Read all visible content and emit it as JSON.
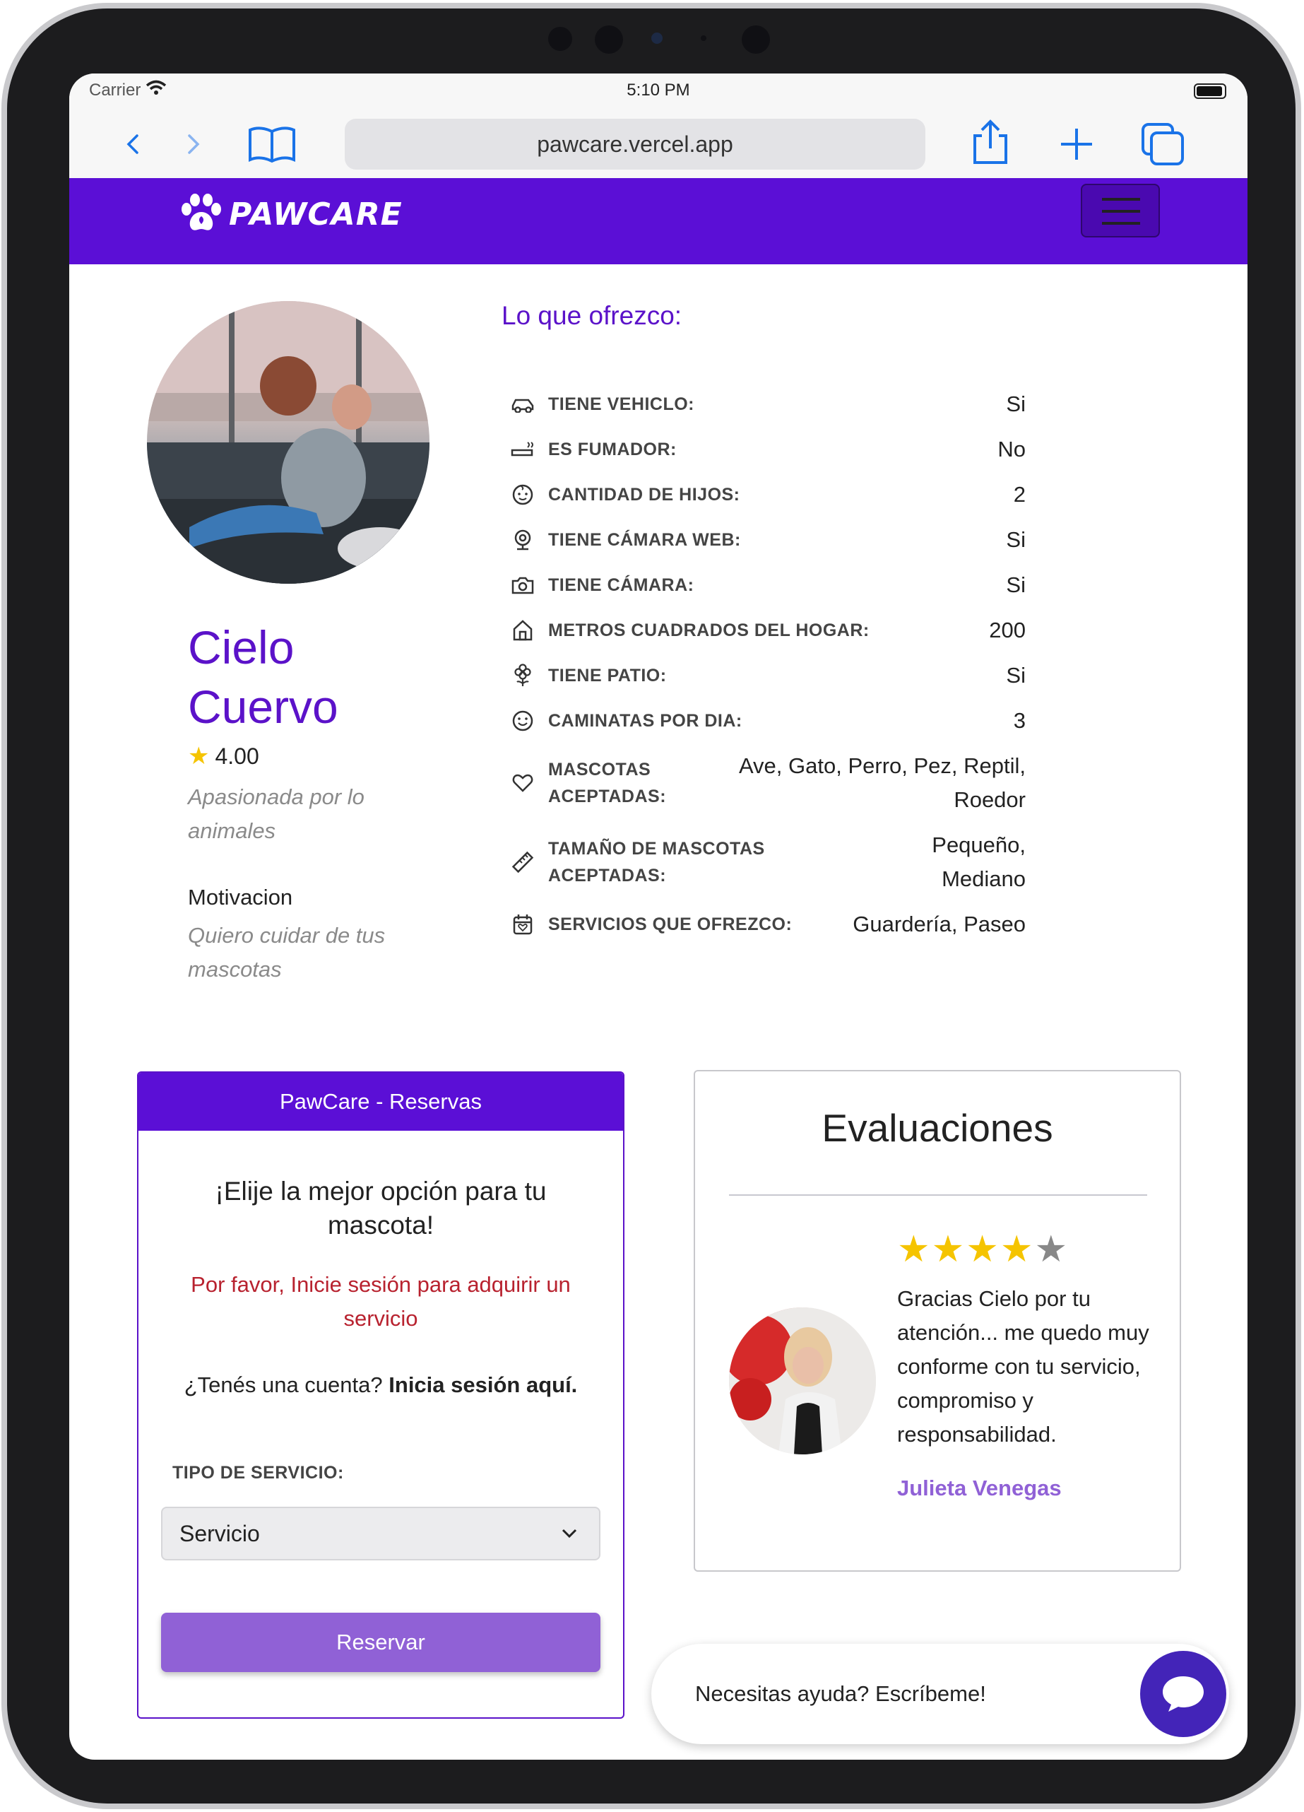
{
  "status_bar": {
    "carrier": "Carrier",
    "time": "5:10 PM"
  },
  "browser": {
    "url": "pawcare.vercel.app"
  },
  "navbar": {
    "brand": "PAWCARE"
  },
  "profile": {
    "name": "Cielo Cuervo",
    "rating": "4.00",
    "bio": "Apasionada por lo animales",
    "motivation_title": "Motivacion",
    "motivation_text": "Quiero cuidar de tus mascotas"
  },
  "offers": {
    "title": "Lo que ofrezco:",
    "items": [
      {
        "icon": "car-icon",
        "label": "TIENE VEHICLO:",
        "value": "Si"
      },
      {
        "icon": "smoking-icon",
        "label": "ES FUMADOR:",
        "value": "No"
      },
      {
        "icon": "baby-icon",
        "label": "CANTIDAD DE HIJOS:",
        "value": "2"
      },
      {
        "icon": "webcam-icon",
        "label": "TIENE CÁMARA WEB:",
        "value": "Si"
      },
      {
        "icon": "camera-icon",
        "label": "TIENE CÁMARA:",
        "value": "Si"
      },
      {
        "icon": "home-icon",
        "label": "METROS CUADRADOS DEL HOGAR:",
        "value": "200"
      },
      {
        "icon": "flower-icon",
        "label": "TIENE PATIO:",
        "value": "Si"
      },
      {
        "icon": "smile-icon",
        "label": "CAMINATAS POR DIA:",
        "value": "3"
      },
      {
        "icon": "heart-icon",
        "label": "MASCOTAS ACEPTADAS:",
        "value": "Ave, Gato, Perro, Pez, Reptil, Roedor"
      },
      {
        "icon": "ruler-icon",
        "label": "TAMAÑO DE MASCOTAS ACEPTADAS:",
        "value": "Pequeño, Mediano"
      },
      {
        "icon": "calendar-icon",
        "label": "SERVICIOS QUE OFREZCO:",
        "value": "Guardería, Paseo"
      }
    ]
  },
  "booking": {
    "header": "PawCare - Reservas",
    "title": "¡Elije la mejor opción para tu mascota!",
    "error": "Por favor, Inicie sesión para adquirir un servicio",
    "login_prompt": "¿Tenés una cuenta?",
    "login_link": "Inicia sesión aquí.",
    "service_label": "TIPO DE SERVICIO:",
    "service_selected": "Servicio",
    "reserve_button": "Reservar"
  },
  "evaluations": {
    "title": "Evaluaciones",
    "review": {
      "stars": 4,
      "max_stars": 5,
      "text": "Gracias Cielo por tu atención... me quedo muy conforme con tu servicio, compromiso y responsabilidad.",
      "author": "Julieta Venegas"
    }
  },
  "chat": {
    "text": "Necesitas ayuda? Escríbeme!"
  },
  "colors": {
    "brand": "#5b0fd6",
    "accent": "#9061d6",
    "error": "#b8222f",
    "star": "#f5c400"
  }
}
